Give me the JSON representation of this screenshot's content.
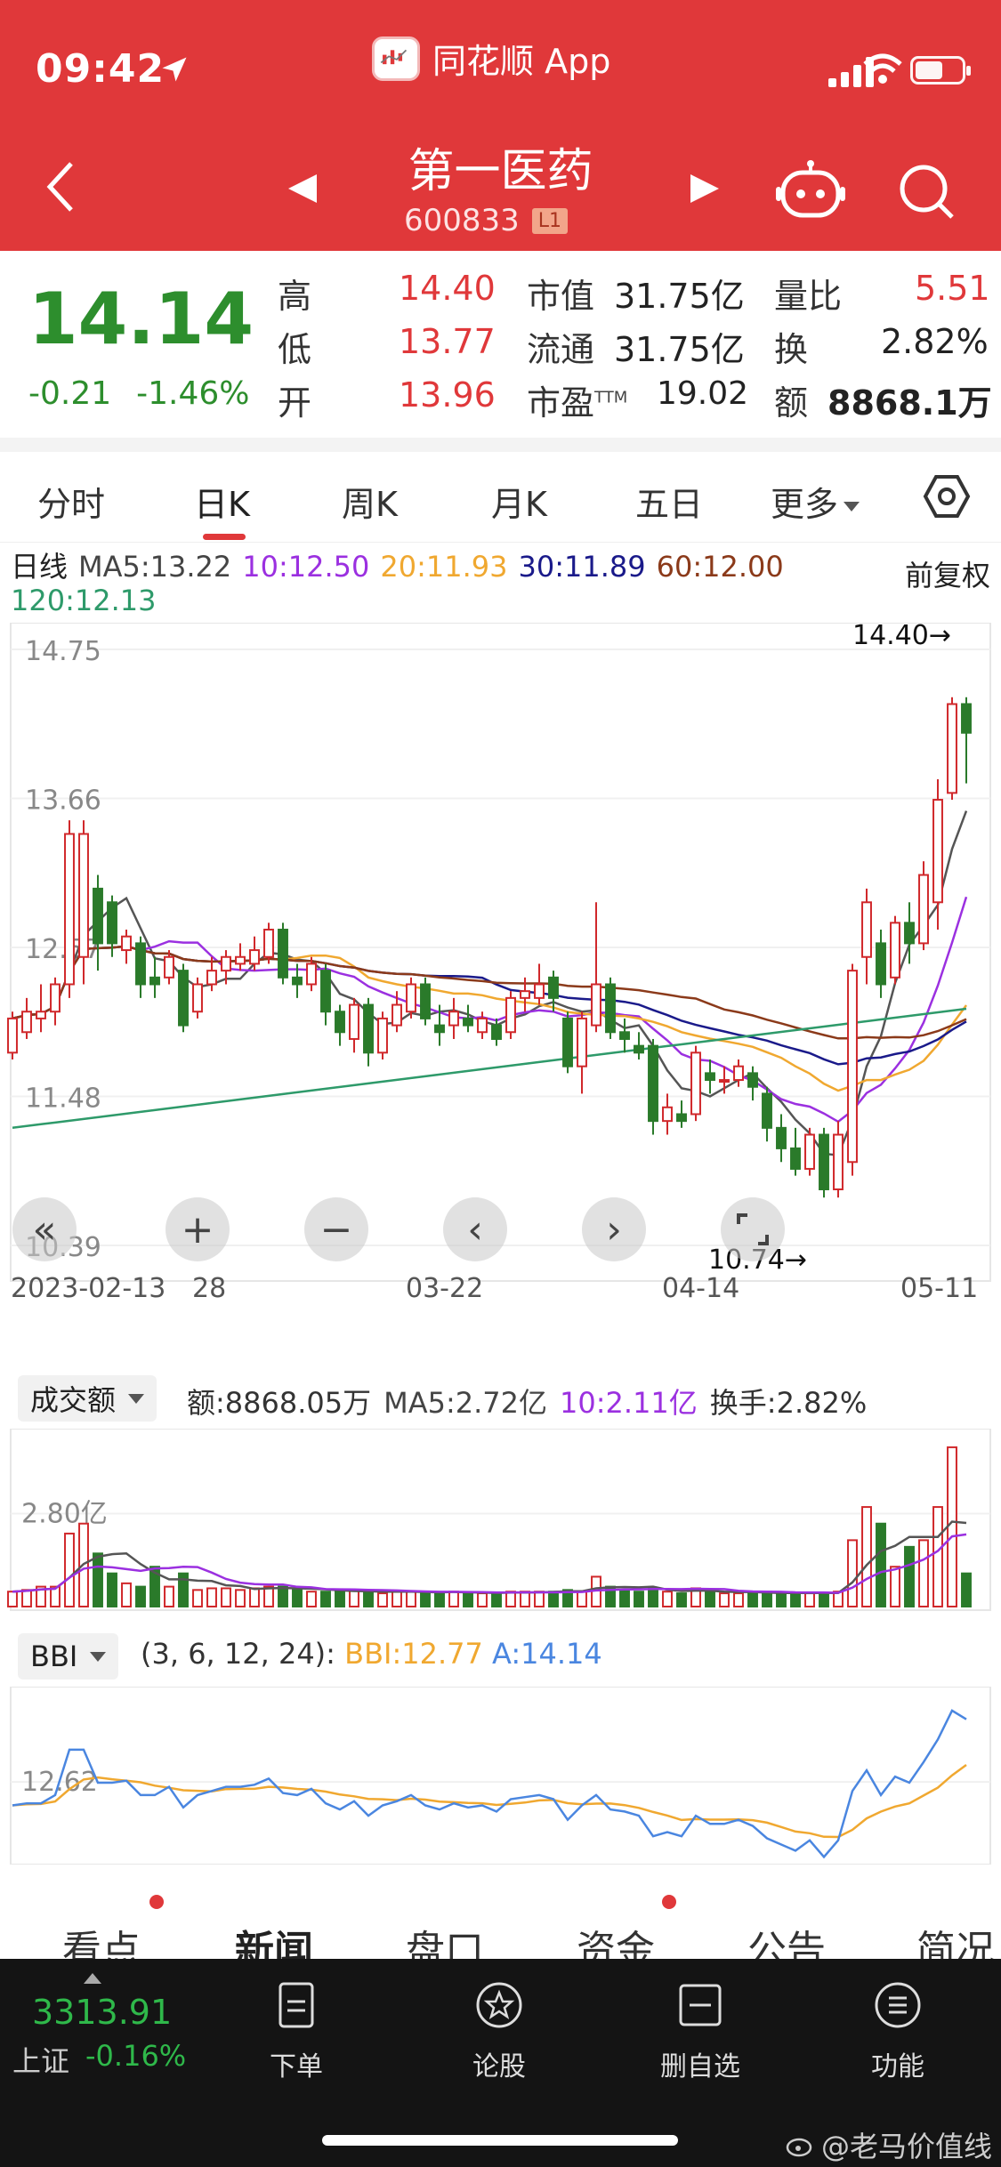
{
  "status_bar": {
    "time": "09:42"
  },
  "app": {
    "name": "同花顺 App"
  },
  "stock": {
    "name": "第一医药",
    "code": "600833",
    "level_badge": "L1"
  },
  "quote": {
    "price": "14.14",
    "change": "-0.21",
    "change_pct": "-1.46%",
    "high_label": "高",
    "high": "14.40",
    "low_label": "低",
    "low": "13.77",
    "open_label": "开",
    "open": "13.96",
    "mktcap_label": "市值",
    "mktcap": "31.75亿",
    "float_label": "流通",
    "float": "31.75亿",
    "pe_label": "市盈",
    "pe_sup": "TTM",
    "pe": "19.02",
    "volratio_label": "量比",
    "volratio": "5.51",
    "turnover_label": "换",
    "turnover": "2.82%",
    "amount_label": "额",
    "amount": "8868.1万"
  },
  "tabs": [
    {
      "label": "分时"
    },
    {
      "label": "日K"
    },
    {
      "label": "周K"
    },
    {
      "label": "月K"
    },
    {
      "label": "五日"
    },
    {
      "label": "更多"
    }
  ],
  "ma_legend": {
    "period": "日线",
    "ma5": "MA5:13.22",
    "ma10": "10:12.50",
    "ma20": "20:11.93",
    "ma30": "30:11.89",
    "ma60": "60:12.00",
    "ma120": "120:12.13",
    "adjust": "前复权"
  },
  "colors": {
    "up": "#d0282b",
    "down": "#2a7a2a",
    "ma5": "#555555",
    "ma10": "#9b30e0",
    "ma20": "#f0a830",
    "ma30": "#1a1a8a",
    "ma60": "#8b3a1a",
    "ma120": "#2e9a6a",
    "bbi": "#f0a830",
    "bbi_a": "#4a86e0"
  },
  "chart_data": {
    "type": "candlestick",
    "y_ticks": [
      "14.75",
      "13.66",
      "12.57",
      "11.48",
      "10.39"
    ],
    "x_ticks": [
      "2023-02-13",
      "28",
      "03-22",
      "04-14",
      "05-11"
    ],
    "max_label": "14.40→",
    "min_label": "10.74→",
    "ylim": [
      10.39,
      14.75
    ],
    "candles": [
      [
        11.8,
        12.05,
        12.1,
        11.75
      ],
      [
        11.95,
        12.1,
        12.2,
        11.9
      ],
      [
        12.05,
        12.1,
        12.3,
        11.95
      ],
      [
        12.1,
        12.3,
        12.35,
        12.0
      ],
      [
        12.3,
        13.4,
        13.5,
        12.2
      ],
      [
        12.5,
        13.4,
        13.5,
        12.3
      ],
      [
        13.0,
        12.6,
        13.1,
        12.4
      ],
      [
        12.9,
        12.6,
        12.95,
        12.5
      ],
      [
        12.55,
        12.65,
        12.7,
        12.45
      ],
      [
        12.6,
        12.3,
        12.65,
        12.2
      ],
      [
        12.35,
        12.3,
        12.5,
        12.2
      ],
      [
        12.35,
        12.5,
        12.55,
        12.3
      ],
      [
        12.4,
        12.0,
        12.45,
        11.95
      ],
      [
        12.1,
        12.3,
        12.35,
        12.05
      ],
      [
        12.3,
        12.4,
        12.5,
        12.25
      ],
      [
        12.4,
        12.5,
        12.55,
        12.3
      ],
      [
        12.45,
        12.5,
        12.6,
        12.4
      ],
      [
        12.45,
        12.55,
        12.65,
        12.4
      ],
      [
        12.5,
        12.7,
        12.75,
        12.45
      ],
      [
        12.7,
        12.35,
        12.75,
        12.3
      ],
      [
        12.35,
        12.3,
        12.45,
        12.2
      ],
      [
        12.3,
        12.45,
        12.5,
        12.25
      ],
      [
        12.4,
        12.1,
        12.45,
        12.0
      ],
      [
        12.1,
        11.95,
        12.15,
        11.85
      ],
      [
        11.9,
        12.15,
        12.2,
        11.8
      ],
      [
        12.15,
        11.8,
        12.2,
        11.7
      ],
      [
        11.8,
        12.05,
        12.1,
        11.75
      ],
      [
        12.0,
        12.15,
        12.25,
        11.95
      ],
      [
        12.1,
        12.3,
        12.35,
        12.05
      ],
      [
        12.3,
        12.05,
        12.35,
        12.0
      ],
      [
        12.0,
        11.95,
        12.15,
        11.85
      ],
      [
        12.0,
        12.1,
        12.2,
        11.9
      ],
      [
        12.05,
        12.0,
        12.15,
        11.95
      ],
      [
        11.95,
        12.05,
        12.1,
        11.9
      ],
      [
        12.0,
        11.9,
        12.05,
        11.85
      ],
      [
        11.95,
        12.2,
        12.25,
        11.9
      ],
      [
        12.2,
        12.25,
        12.35,
        12.1
      ],
      [
        12.2,
        12.3,
        12.45,
        12.15
      ],
      [
        12.35,
        12.2,
        12.4,
        12.1
      ],
      [
        12.05,
        11.7,
        12.1,
        11.65
      ],
      [
        11.7,
        12.05,
        12.1,
        11.5
      ],
      [
        12.0,
        12.3,
        12.9,
        11.95
      ],
      [
        12.3,
        11.95,
        12.35,
        11.9
      ],
      [
        11.95,
        11.9,
        12.05,
        11.8
      ],
      [
        11.85,
        11.8,
        11.95,
        11.75
      ],
      [
        11.85,
        11.3,
        11.9,
        11.2
      ],
      [
        11.3,
        11.4,
        11.5,
        11.2
      ],
      [
        11.35,
        11.3,
        11.45,
        11.25
      ],
      [
        11.35,
        11.8,
        11.85,
        11.3
      ],
      [
        11.65,
        11.6,
        11.75,
        11.5
      ],
      [
        11.6,
        11.6,
        11.7,
        11.5
      ],
      [
        11.6,
        11.7,
        11.75,
        11.55
      ],
      [
        11.65,
        11.55,
        11.7,
        11.45
      ],
      [
        11.5,
        11.25,
        11.55,
        11.15
      ],
      [
        11.25,
        11.1,
        11.35,
        11.0
      ],
      [
        11.1,
        10.95,
        11.25,
        10.9
      ],
      [
        10.95,
        11.2,
        11.25,
        10.9
      ],
      [
        11.2,
        10.8,
        11.25,
        10.74
      ],
      [
        10.8,
        11.2,
        11.3,
        10.74
      ],
      [
        11.0,
        12.4,
        12.45,
        10.9
      ],
      [
        12.5,
        12.9,
        13.0,
        12.3
      ],
      [
        12.6,
        12.3,
        12.7,
        12.2
      ],
      [
        12.35,
        12.75,
        12.8,
        12.3
      ],
      [
        12.75,
        12.6,
        12.9,
        12.45
      ],
      [
        12.6,
        13.1,
        13.2,
        12.55
      ],
      [
        12.9,
        13.65,
        13.8,
        12.7
      ],
      [
        13.7,
        14.35,
        14.4,
        13.65
      ],
      [
        14.35,
        14.14,
        14.4,
        13.77
      ]
    ],
    "volume": {
      "label": "成交额",
      "amount": "额:8868.05万",
      "ma5": "MA5:2.72亿",
      "ma10": "10:2.11亿",
      "turnover": "换手:2.82%",
      "y_tick": "2.80亿",
      "values": [
        0.45,
        0.5,
        0.6,
        0.6,
        2.2,
        2.5,
        1.6,
        1.0,
        0.7,
        0.6,
        1.2,
        0.6,
        1.0,
        0.5,
        0.55,
        0.55,
        0.5,
        0.55,
        0.6,
        0.6,
        0.5,
        0.45,
        0.45,
        0.45,
        0.5,
        0.45,
        0.4,
        0.45,
        0.45,
        0.45,
        0.4,
        0.45,
        0.4,
        0.4,
        0.4,
        0.45,
        0.45,
        0.45,
        0.45,
        0.5,
        0.45,
        0.9,
        0.6,
        0.5,
        0.45,
        0.55,
        0.45,
        0.4,
        0.55,
        0.45,
        0.4,
        0.4,
        0.4,
        0.45,
        0.4,
        0.4,
        0.4,
        0.4,
        0.45,
        2.0,
        3.0,
        2.5,
        1.2,
        1.8,
        2.0,
        3.0,
        4.8,
        1.0
      ]
    },
    "bbi": {
      "label": "BBI",
      "params": "(3, 6, 12, 24):",
      "bbi": "BBI:12.77",
      "a": "A:14.14",
      "y_tick": "12.62"
    }
  },
  "news_tabs": [
    {
      "label": "看点"
    },
    {
      "label": "新闻"
    },
    {
      "label": "盘口"
    },
    {
      "label": "资金"
    },
    {
      "label": "公告"
    },
    {
      "label": "简况"
    }
  ],
  "bottom_bar": {
    "index_value": "3313.91",
    "index_name": "上证",
    "index_change": "-0.16%",
    "nav": [
      {
        "label": "下单"
      },
      {
        "label": "论股"
      },
      {
        "label": "删自选"
      },
      {
        "label": "功能"
      }
    ]
  },
  "watermark": "@老马价值线"
}
